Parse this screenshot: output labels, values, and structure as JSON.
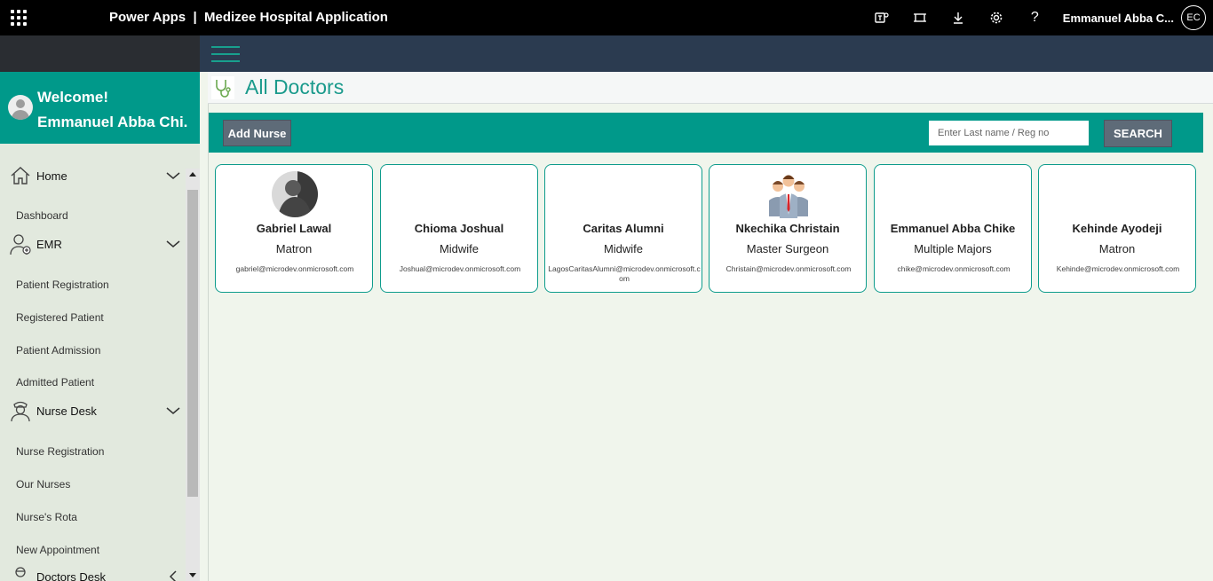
{
  "topbar": {
    "app_title": "Power Apps  |  Medizee Hospital Application",
    "user_name": "Emmanuel Abba C...",
    "user_initials": "EC",
    "icons": [
      "teams-icon",
      "fit-screen-icon",
      "download-icon",
      "settings-icon",
      "help-icon"
    ]
  },
  "sidebar": {
    "welcome": "Welcome!",
    "user_full_name": "Emmanuel Abba Chi...",
    "groups": [
      {
        "label": "Home",
        "icon": "home-icon",
        "items": [
          "Dashboard"
        ]
      },
      {
        "label": "EMR",
        "icon": "doctor-icon",
        "items": [
          "Patient Registration",
          "Registered Patient",
          "Patient Admission",
          "Admitted Patient"
        ]
      },
      {
        "label": "Nurse Desk",
        "icon": "nurse-icon",
        "items": [
          "Nurse Registration",
          "Our Nurses",
          "Nurse's Rota",
          "New Appointment"
        ]
      },
      {
        "label": "Doctors Desk",
        "icon": "doctor-desk-icon",
        "items": []
      }
    ]
  },
  "page": {
    "title": "All Doctors",
    "add_button": "Add Nurse",
    "search_placeholder": "Enter Last name / Reg no",
    "search_button": "SEARCH"
  },
  "cards": [
    {
      "name": "Gabriel Lawal",
      "role": "Matron",
      "email": "gabriel@microdev.onmicrosoft.com",
      "photo": "person-photo"
    },
    {
      "name": "Chioma Joshual",
      "role": "Midwife",
      "email": "Joshual@microdev.onmicrosoft.com",
      "photo": "none"
    },
    {
      "name": "Caritas Alumni",
      "role": "Midwife",
      "email": "LagosCaritasAlumni@microdev.onmicrosoft.com",
      "photo": "none"
    },
    {
      "name": "Nkechika Christain",
      "role": "Master Surgeon",
      "email": "Christain@microdev.onmicrosoft.com",
      "photo": "team-icon"
    },
    {
      "name": "Emmanuel Abba Chike",
      "role": "Multiple Majors",
      "email": "chike@microdev.onmicrosoft.com",
      "photo": "none"
    },
    {
      "name": "Kehinde Ayodeji",
      "role": "Matron",
      "email": "Kehinde@microdev.onmicrosoft.com",
      "photo": "none"
    }
  ]
}
